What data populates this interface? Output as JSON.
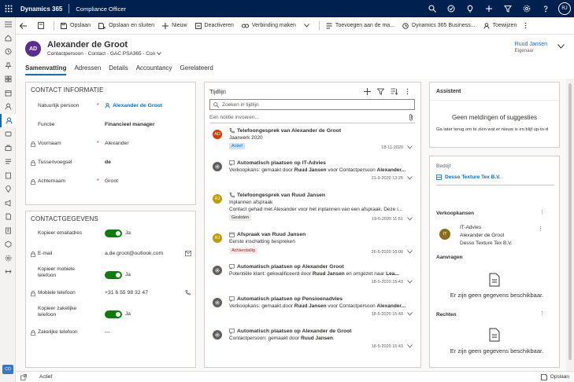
{
  "topbar": {
    "app_name": "Dynamics 365",
    "area_name": "Compliance Officer",
    "user_initials": "RJ"
  },
  "commands": [
    {
      "label": "Opslaan",
      "icon": "save-icon"
    },
    {
      "label": "Opslaan en sluiten",
      "icon": "save-close-icon"
    },
    {
      "label": "Nieuw",
      "icon": "plus-icon"
    },
    {
      "label": "Deactiveren",
      "icon": "deactivate-icon"
    },
    {
      "label": "Verbinding maken",
      "icon": "connect-icon"
    },
    {
      "label": "Toevoegen aan de ma...",
      "icon": "marketing-icon"
    },
    {
      "label": "Dynamics 365 Business...",
      "icon": "business-icon"
    },
    {
      "label": "Toewijzen",
      "icon": "assign-icon"
    }
  ],
  "record": {
    "initials": "AD",
    "name": "Alexander de Groot",
    "entity": "Contactpersoon",
    "form": "Contact - GAC PSA365 - Con",
    "owner_name": "Ruud Jansen",
    "owner_label": "Eigenaar"
  },
  "tabs": [
    "Samenvatting",
    "Adressen",
    "Details",
    "Accountancy",
    "Gerelateerd"
  ],
  "contact_info": {
    "title": "CONTACT INFORMATIE",
    "fields": [
      {
        "label": "Natuurlijk persoon",
        "value": "Alexander de Groot",
        "required": "*"
      },
      {
        "label": "Functie",
        "value": "Financieel manager"
      },
      {
        "label": "Voornaam",
        "value": "Alexander",
        "required": "*"
      },
      {
        "label": "Tussenvoegsel",
        "value": "de"
      },
      {
        "label": "Achternaam",
        "value": "Groot",
        "required": "*"
      }
    ]
  },
  "contact_details": {
    "title": "CONTACTGEGEVENS",
    "fields": [
      {
        "label": "Kopieer emailadres",
        "value": "Ja"
      },
      {
        "label": "E-mail",
        "value": "a.de.groot@outlook.com"
      },
      {
        "label": "Kopieer mobiele telefoon",
        "value": "Ja"
      },
      {
        "label": "Mobiele telefoon",
        "value": "+31 6 55 98 32 47"
      },
      {
        "label": "Kopieer zakelijke telefoon",
        "value": "Ja"
      },
      {
        "label": "Zakelijke telefoon",
        "value": "---"
      }
    ]
  },
  "timeline": {
    "title": "Tijdlijn",
    "search_placeholder": "Zoeken in tijdlijn",
    "note_placeholder": "Een notitie invoeren...",
    "items": [
      {
        "initials": "AD",
        "avatar_color": "#d83b01",
        "title": "Telefoongesprek van Alexander de Groot",
        "line1_pre": "Jaarwerk 2020",
        "badge": "Actief",
        "badge_bg": "#cfe4fa",
        "badge_color": "#0f6cbd",
        "date": "18-11-2020"
      },
      {
        "initials": "",
        "avatar_color": "#605e5c",
        "title": "Automatisch plaatsen op IT-Advies",
        "line1_pre": "Verkoopkans: gemaakt door ",
        "line1_b1": "Ruud Jansen",
        "line1_mid": " voor Contactpersoon ",
        "line1_b2": "Alexander...",
        "date": "21-9-2020 13:25"
      },
      {
        "initials": "RJ",
        "avatar_color": "#c19c00",
        "title": "Telefoongesprek van Ruud Jansen",
        "line1_pre": "Inplannen afspraak",
        "line2": "Contact gehad met Alexander voor het inplannen van een afspraak. Deze i...",
        "badge": "Gesloten",
        "badge_bg": "#edebe9",
        "badge_color": "#323130",
        "date": "19-5-2020 11:51"
      },
      {
        "initials": "RJ",
        "avatar_color": "#c19c00",
        "title": "Afspraak van Ruud Jansen",
        "line1_pre": "Eerste inschatting bespreken",
        "badge": "Achterstallig",
        "badge_bg": "#fde7e9",
        "badge_color": "#a4262c",
        "date": "26-5-2020 10:00"
      },
      {
        "initials": "",
        "avatar_color": "#605e5c",
        "title": "Automatisch plaatsen op Alexander Groot",
        "line1_pre": "Potentiële klant: gekwalificeerd door ",
        "line1_b1": "Ruud Jansen",
        "line1_mid": " en omgezet naar ",
        "line1_b2": "Lea...",
        "date": "18-5-2020 15:43"
      },
      {
        "initials": "",
        "avatar_color": "#605e5c",
        "title": "Automatisch plaatsen op Pensioenadvies",
        "line1_pre": "Verkoopkans: gemaakt door ",
        "line1_b1": "Ruud Jansen",
        "line1_mid": " voor Contactpersoon ",
        "line1_b2": "Alexander...",
        "date": "18-5-2020 15:43"
      },
      {
        "initials": "",
        "avatar_color": "#605e5c",
        "title": "Automatisch plaatsen op Alexander de Groot",
        "line1_pre": "Contactpersoon: gemaakt door ",
        "line1_b1": "Ruud Jansen",
        "line1_mid": ".",
        "date": "18-5-2020 15:43"
      }
    ]
  },
  "assistant": {
    "title": "Assistent",
    "heading": "Geen meldingen of suggesties",
    "text": "Ga later terug om te zien wat er nieuw is en blijf up-to-d"
  },
  "related": {
    "company_label": "Bedrijf",
    "company_name": "Desso Texture Tex B.V.",
    "opportunities_label": "Verkoopkansen",
    "opportunity": {
      "initials": "IT",
      "name": "IT-Advies",
      "contact": "Alexander de Groot",
      "company": "Desso Texture Tex B.V."
    },
    "requests_label": "Aanvragen",
    "empty_text": "Er zijn geen gegevens beschikbaar.",
    "rights_label": "Rechten"
  },
  "statusbar": {
    "status": "Actief",
    "save": "Opslaan"
  }
}
